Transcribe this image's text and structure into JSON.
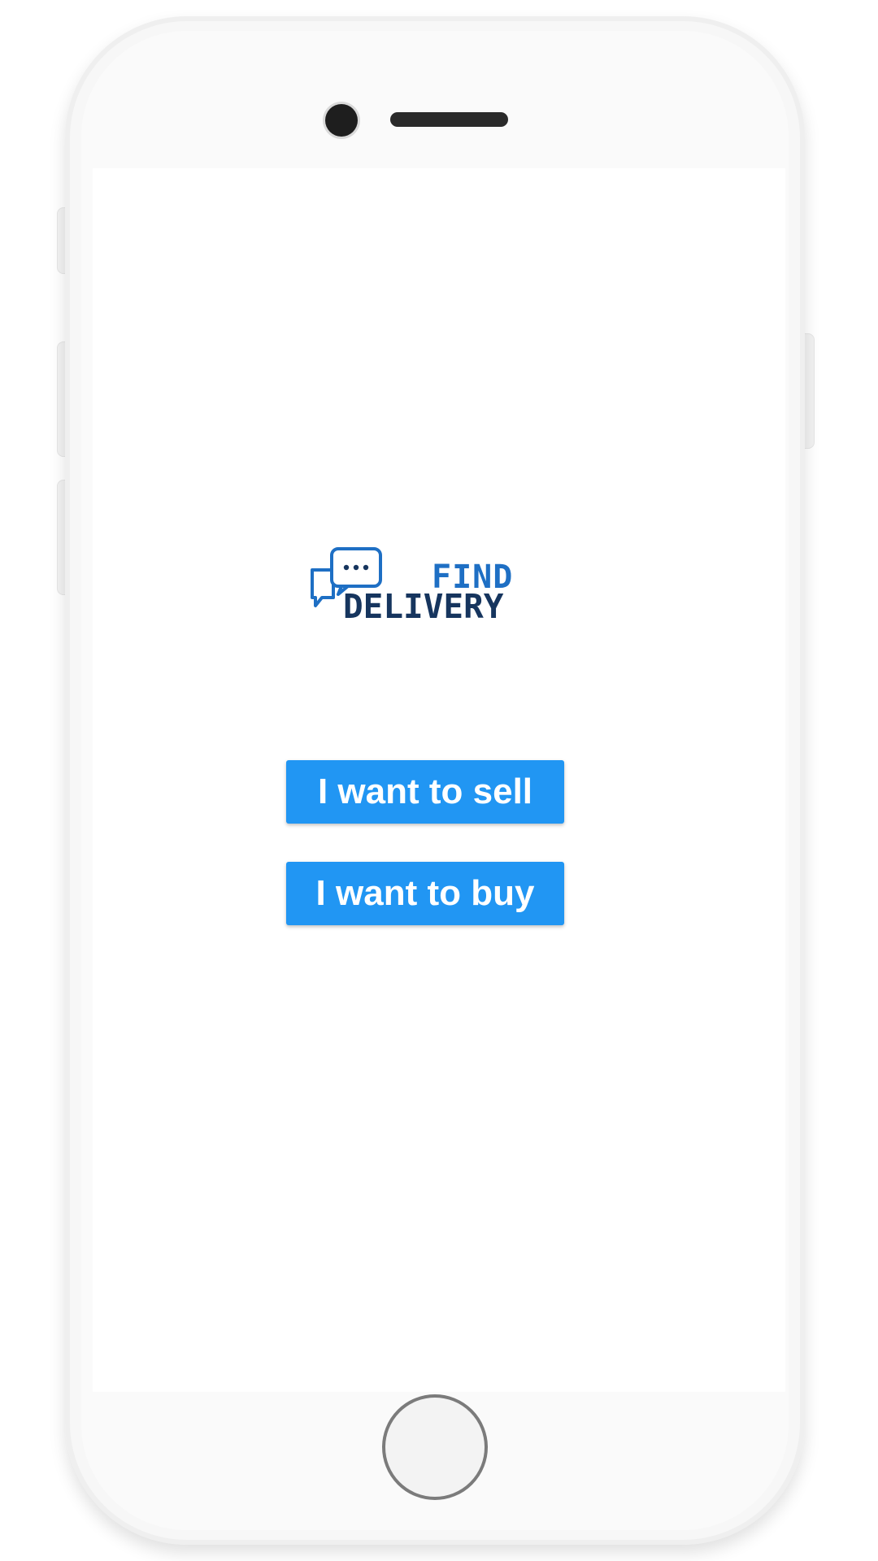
{
  "app": {
    "logo": {
      "word_top": "FIND",
      "word_bottom": "DELIVERY",
      "icon": "chat-bubbles-icon",
      "colors": {
        "primary": "#1e6fc4",
        "dark": "#16355e"
      }
    },
    "actions": {
      "sell_label": "I want to sell",
      "buy_label": "I want to buy"
    },
    "colors": {
      "button": "#2196f3",
      "button_text": "#ffffff",
      "background": "#ffffff"
    }
  },
  "device": {
    "frame": "phone-mockup",
    "home_button_icon": "home-button-icon",
    "camera_icon": "front-camera-icon",
    "speaker_icon": "speaker-grille-icon"
  }
}
